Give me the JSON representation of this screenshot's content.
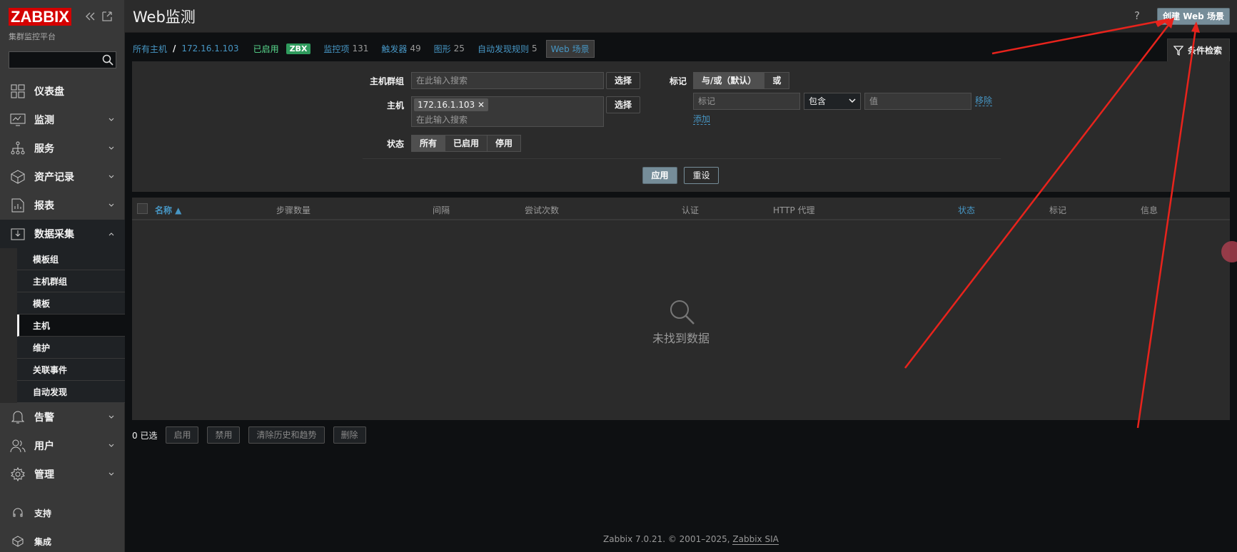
{
  "sidebar": {
    "logo": "ZABBIX",
    "subtitle": "集群监控平台",
    "search_placeholder": "",
    "menu": [
      {
        "label": "仪表盘"
      },
      {
        "label": "监测"
      },
      {
        "label": "服务"
      },
      {
        "label": "资产记录"
      },
      {
        "label": "报表"
      },
      {
        "label": "数据采集"
      }
    ],
    "submenu": [
      {
        "label": "模板组"
      },
      {
        "label": "主机群组"
      },
      {
        "label": "模板"
      },
      {
        "label": "主机"
      },
      {
        "label": "维护"
      },
      {
        "label": "关联事件"
      },
      {
        "label": "自动发现"
      }
    ],
    "menu2": [
      {
        "label": "告警"
      },
      {
        "label": "用户"
      },
      {
        "label": "管理"
      }
    ],
    "bottom": [
      {
        "label": "支持"
      },
      {
        "label": "集成"
      }
    ]
  },
  "header": {
    "title": "Web监测",
    "help": "?",
    "create_button": "创建 Web 场景"
  },
  "breadcrumb": {
    "all_hosts": "所有主机",
    "sep": "/",
    "host": "172.16.1.103",
    "enabled": "已启用",
    "zbx": "ZBX",
    "items_label": "监控项",
    "items_count": "131",
    "triggers_label": "触发器",
    "triggers_count": "49",
    "graphs_label": "图形",
    "graphs_count": "25",
    "discovery_label": "自动发现规则",
    "discovery_count": "5",
    "web_label": "Web 场景"
  },
  "filter": {
    "tab_label": "条件检索",
    "hostgroup_label": "主机群组",
    "hostgroup_placeholder": "在此输入搜索",
    "select_btn": "选择",
    "host_label": "主机",
    "host_chip": "172.16.1.103",
    "host_placeholder": "在此输入搜索",
    "status_label": "状态",
    "status_options": [
      "所有",
      "已启用",
      "停用"
    ],
    "tags_label": "标记",
    "tags_mode": [
      "与/或（默认）",
      "或"
    ],
    "tag_placeholder": "标记",
    "tag_operator": "包含",
    "value_placeholder": "值",
    "remove_link": "移除",
    "add_link": "添加",
    "apply": "应用",
    "reset": "重设"
  },
  "table": {
    "columns": [
      "名称 ▲",
      "步骤数量",
      "间隔",
      "尝试次数",
      "认证",
      "HTTP 代理",
      "状态",
      "标记",
      "信息"
    ],
    "empty": "未找到数据"
  },
  "footer_actions": {
    "selected": "0 已选",
    "buttons": [
      "启用",
      "禁用",
      "清除历史和趋势",
      "删除"
    ]
  },
  "copyright": {
    "text": "Zabbix 7.0.21. © 2001–2025, ",
    "link": "Zabbix SIA"
  },
  "colors": {
    "accent": "#768d99",
    "link": "#4796c4",
    "logo_red": "#d40000",
    "annotation_arrow": "#e8231c"
  }
}
